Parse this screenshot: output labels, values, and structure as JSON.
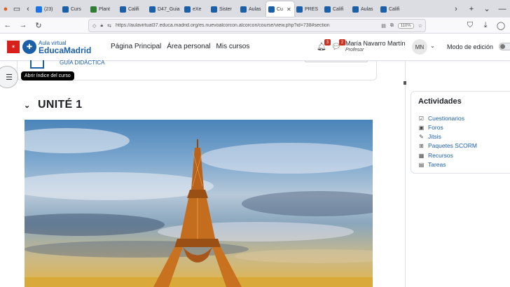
{
  "browser": {
    "tabs": [
      {
        "label": "(23)",
        "color": "#1a73e8"
      },
      {
        "label": "Curs",
        "color": "#1b5fa8"
      },
      {
        "label": "Plant",
        "color": "#2e7d32"
      },
      {
        "label": "Califi",
        "color": "#1b5fa8"
      },
      {
        "label": "D47_Guia",
        "color": "#1b5fa8"
      },
      {
        "label": "eXe",
        "color": "#1b5fa8"
      },
      {
        "label": "Sister",
        "color": "#1b5fa8"
      },
      {
        "label": "Aulas",
        "color": "#1b5fa8"
      },
      {
        "label": "Cu",
        "color": "#1b5fa8",
        "active": true
      },
      {
        "label": "PRES",
        "color": "#1b5fa8"
      },
      {
        "label": "Califi",
        "color": "#1b5fa8"
      },
      {
        "label": "Aulas",
        "color": "#1b5fa8"
      },
      {
        "label": "Califi",
        "color": "#1b5fa8"
      }
    ],
    "url": "https://aulavirtual37.educa.madrid.org/es.nuevoalcorcon.alcorcon/course/view.php?id=738#section",
    "zoom": "110%"
  },
  "header": {
    "logo_small": "Aula virtual",
    "logo_big": "EducaMadrid",
    "menu": [
      "Página Principal",
      "Área personal",
      "Mis cursos"
    ],
    "notifications_count": "3",
    "messages_count": "2",
    "user_name": "María Navarro Martín",
    "user_role": "Profesor",
    "avatar_initials": "MN",
    "edit_mode_label": "Modo de edición"
  },
  "content": {
    "drawer_tooltip": "Abrir índice del curso",
    "previous_link": "GUÍA DIDÁCTICA",
    "section_title": "UNITÉ 1"
  },
  "activities": {
    "title": "Actividades",
    "items": [
      {
        "label": "Cuestionarios",
        "icon": "checklist-icon"
      },
      {
        "label": "Foros",
        "icon": "forum-icon"
      },
      {
        "label": "Jitsis",
        "icon": "jitsi-icon"
      },
      {
        "label": "Paquetes SCORM",
        "icon": "package-icon"
      },
      {
        "label": "Recursos",
        "icon": "resource-icon"
      },
      {
        "label": "Tareas",
        "icon": "assignment-icon"
      }
    ]
  }
}
